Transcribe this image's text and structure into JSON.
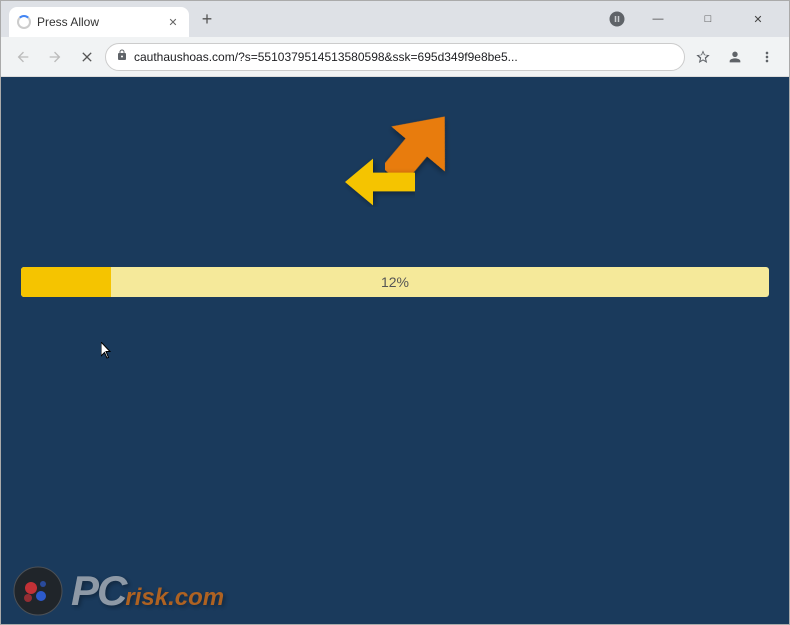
{
  "browser": {
    "tab": {
      "title": "Press Allow",
      "loading": true
    },
    "url": "cauthaushoas.com/?s=5510379514513580598&ssk=695d349f9e8be5...",
    "new_tab_label": "+",
    "window_controls": {
      "minimize": "—",
      "maximize": "□",
      "close": "✕"
    }
  },
  "nav": {
    "back": "←",
    "forward": "→",
    "reload": "✕"
  },
  "page": {
    "progress_percent": 12,
    "progress_label": "12%",
    "background_color": "#1a3a5c"
  },
  "watermark": {
    "text_pc": "PC",
    "text_risk": "risk.com"
  }
}
